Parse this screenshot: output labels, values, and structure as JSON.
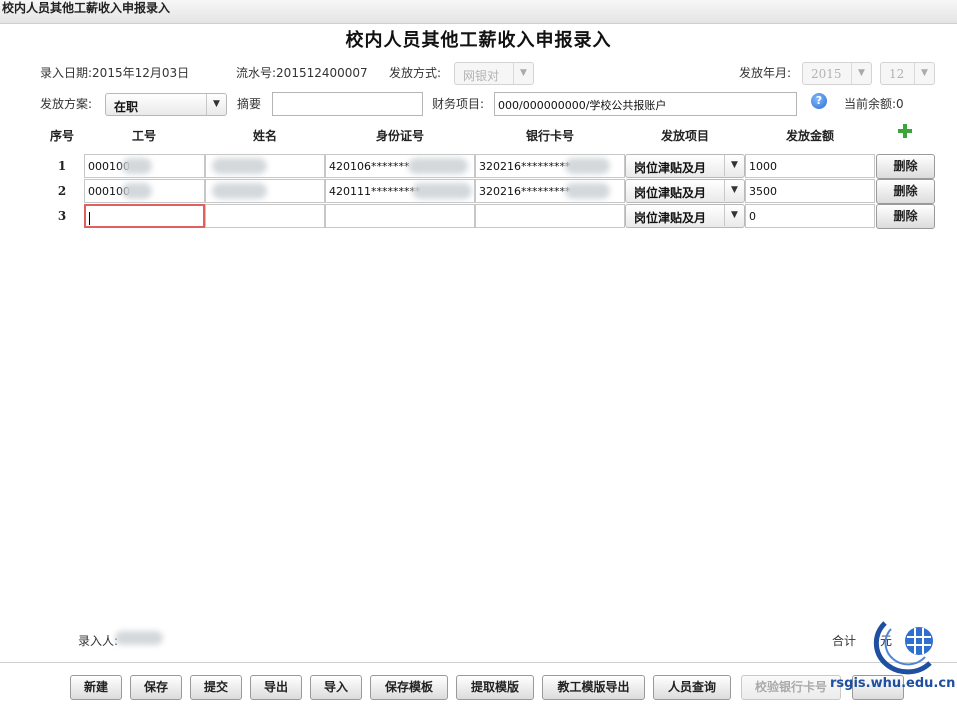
{
  "window": {
    "title": "校内人员其他工薪收入申报录入"
  },
  "page": {
    "title": "校内人员其他工薪收入申报录入"
  },
  "meta": {
    "entry_date_label": "录入日期:",
    "entry_date_value": "2015年12月03日",
    "serial_label": "流水号:",
    "serial_value": "201512400007",
    "payment_method_label": "发放方式:",
    "payment_method_value": "网银对",
    "pay_period_label": "发放年月:",
    "year_value": "2015",
    "month_value": "12"
  },
  "form": {
    "scheme_label": "发放方案:",
    "scheme_value": "在职",
    "summary_label": "摘要",
    "summary_value": "",
    "finance_label": "财务项目:",
    "finance_value": "000/000000000/学校公共报账户",
    "balance_label": "当前余额:",
    "balance_value": "0"
  },
  "table": {
    "headers": [
      "序号",
      "工号",
      "姓名",
      "身份证号",
      "银行卡号",
      "发放项目",
      "发放金额"
    ],
    "rows": [
      {
        "no": "1",
        "job_id": "000100",
        "name": "",
        "id_card": "420106*******",
        "bank_card": "320216*********",
        "item": "岗位津贴及月",
        "amount": "1000",
        "delete": "删除"
      },
      {
        "no": "2",
        "job_id": "000100",
        "name": "",
        "id_card": "420111*********",
        "bank_card": "320216*********",
        "item": "岗位津贴及月",
        "amount": "3500",
        "delete": "删除"
      },
      {
        "no": "3",
        "job_id": "",
        "name": "",
        "id_card": "",
        "bank_card": "",
        "item": "岗位津贴及月",
        "amount": "0",
        "delete": "删除"
      }
    ]
  },
  "footer": {
    "entrant_label": "录入人:",
    "total_label": "合计",
    "total_unit": "元"
  },
  "toolbar": {
    "new": "新建",
    "save": "保存",
    "submit": "提交",
    "export": "导出",
    "import": "导入",
    "save_template": "保存模板",
    "fetch_template": "提取模版",
    "staff_template_export": "教工模版导出",
    "person_query": "人员查询",
    "verify_bank_card": "校验银行卡号"
  },
  "watermark": {
    "text": "rsgis.whu.edu.cn"
  }
}
